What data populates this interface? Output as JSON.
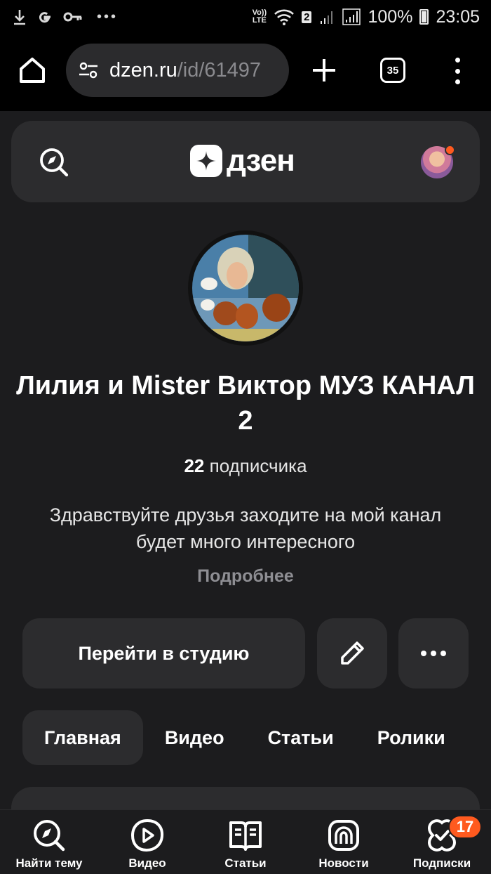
{
  "status_bar": {
    "network_label_top": "Vo))",
    "network_label_bottom": "LTE",
    "sim_slot": "2",
    "battery": "100%",
    "time": "23:05",
    "left_icons": [
      "download-icon",
      "google-icon",
      "key-icon",
      "more-notifications-icon"
    ]
  },
  "browser": {
    "url_host": "dzen.ru",
    "url_path": "/id/61497",
    "tab_count": "35"
  },
  "header": {
    "logo_text": "дзен"
  },
  "channel": {
    "title": "Лилия и Mister Виктор МУЗ КАНАЛ 2",
    "subscribers_count": "22",
    "subscribers_label": "подписчика",
    "description": "Здравствуйте друзья заходите на мой канал будет много интересного",
    "more_label": "Подробнее"
  },
  "actions": {
    "studio_label": "Перейти в студию"
  },
  "tabs": [
    {
      "label": "Главная",
      "active": true
    },
    {
      "label": "Видео",
      "active": false
    },
    {
      "label": "Статьи",
      "active": false
    },
    {
      "label": "Ролики",
      "active": false
    }
  ],
  "bottom_nav": [
    {
      "label": "Найти тему",
      "icon": "compass-search-icon"
    },
    {
      "label": "Видео",
      "icon": "video-icon"
    },
    {
      "label": "Статьи",
      "icon": "book-icon"
    },
    {
      "label": "Новости",
      "icon": "news-icon"
    },
    {
      "label": "Подписки",
      "icon": "subscriptions-icon",
      "badge": "17"
    }
  ],
  "colors": {
    "accent": "#ff5a1f",
    "page_bg": "#1c1c1e",
    "surface": "#2c2c2e"
  }
}
